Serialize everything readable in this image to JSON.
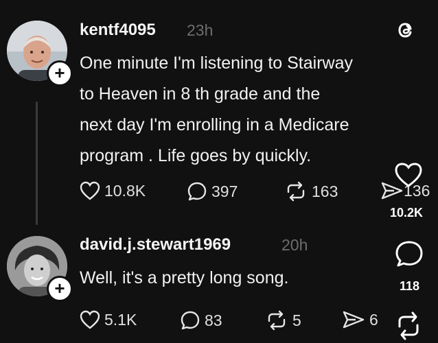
{
  "posts": [
    {
      "username": "kentf4095",
      "time": "23h",
      "text_lines": [
        "One minute I'm listening to Stairway",
        "to Heaven in 8 th grade and the",
        "next day I'm enrolling in a Medicare",
        "program . Life goes by quickly."
      ],
      "likes": "10.8K",
      "replies": "397",
      "reposts": "163",
      "shares": "136"
    },
    {
      "username": "david.j.stewart1969",
      "time": "20h",
      "text_lines": [
        "Well, it's a pretty long song."
      ],
      "likes": "5.1K",
      "replies": "83",
      "reposts": "5",
      "shares": "6"
    }
  ],
  "side_panel": {
    "likes": "10.2K",
    "comments": "118"
  },
  "icons": {
    "logo": "threads-logo-icon",
    "like": "heart-icon",
    "reply": "speech-bubble-icon",
    "repost": "repost-icon",
    "share": "send-icon",
    "follow": "plus-icon"
  },
  "colors": {
    "background": "#111111",
    "text": "#f2f2f2",
    "muted": "#6d6d6d"
  }
}
